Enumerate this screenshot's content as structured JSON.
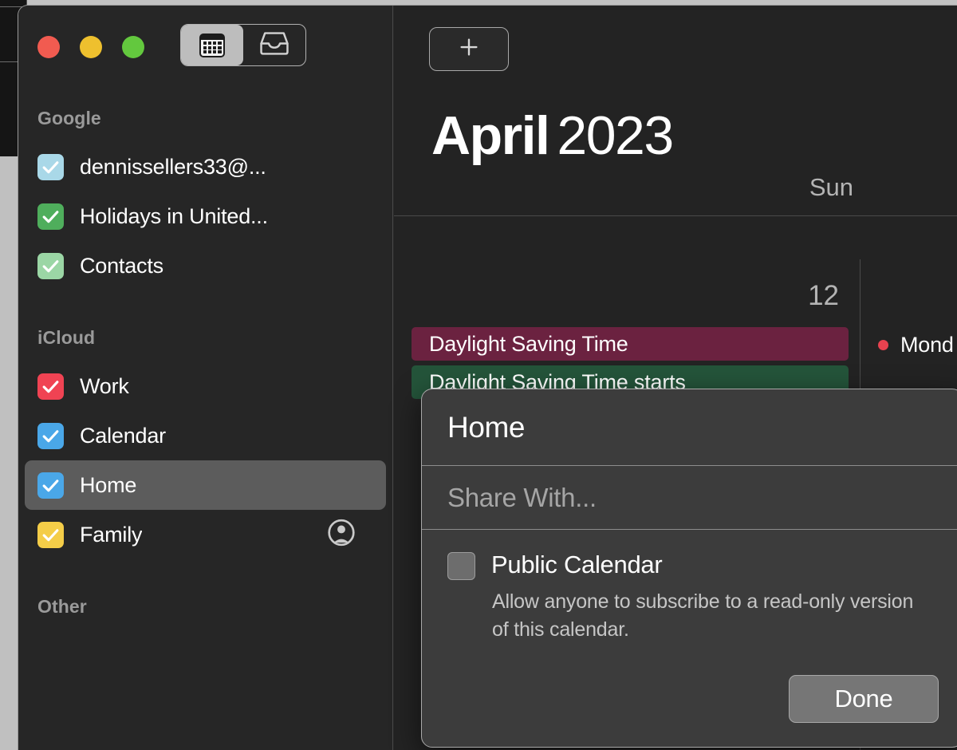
{
  "window": {
    "traffic_lights": [
      {
        "name": "close",
        "color": "#f15b50"
      },
      {
        "name": "minimize",
        "color": "#eec02e"
      },
      {
        "name": "zoom",
        "color": "#63c83e"
      }
    ],
    "view_toggle": [
      {
        "icon": "calendar-grid-icon",
        "active": true
      },
      {
        "icon": "inbox-tray-icon",
        "active": false
      }
    ]
  },
  "sidebar": {
    "sections": [
      {
        "title": "Google",
        "items": [
          {
            "label": "dennissellers33@...",
            "color": "#a9d8e8",
            "checked": true,
            "selected": false,
            "shared": false
          },
          {
            "label": "Holidays in United...",
            "color": "#4fae5c",
            "checked": true,
            "selected": false,
            "shared": false
          },
          {
            "label": "Contacts",
            "color": "#9bd6a5",
            "checked": true,
            "selected": false,
            "shared": false
          }
        ]
      },
      {
        "title": "iCloud",
        "items": [
          {
            "label": "Work",
            "color": "#f04353",
            "checked": true,
            "selected": false,
            "shared": false
          },
          {
            "label": "Calendar",
            "color": "#4aa7e8",
            "checked": true,
            "selected": false,
            "shared": false
          },
          {
            "label": "Home",
            "color": "#4aa7e8",
            "checked": true,
            "selected": true,
            "shared": false
          },
          {
            "label": "Family",
            "color": "#f4cd48",
            "checked": true,
            "selected": false,
            "shared": true
          }
        ]
      },
      {
        "title": "Other",
        "items": []
      }
    ]
  },
  "main": {
    "add_button_icon": "plus-icon",
    "month": "April",
    "year": "2023",
    "weekdays": [
      "Sun"
    ],
    "days": [
      {
        "number": "12",
        "events": [
          {
            "title": "Daylight Saving Time",
            "color": "#6b2240",
            "style": "chip"
          },
          {
            "title": "Daylight Saving Time starts",
            "color": "#24543a",
            "style": "chip"
          }
        ]
      },
      {
        "number": "",
        "events": [
          {
            "title": "Mond",
            "color": "#e8424f",
            "style": "dot"
          }
        ]
      }
    ]
  },
  "popover": {
    "title": "Home",
    "share_placeholder": "Share With...",
    "public_calendar_label": "Public Calendar",
    "public_calendar_checked": false,
    "public_calendar_description": "Allow anyone to subscribe to a read-only version of this calendar.",
    "done_label": "Done"
  }
}
